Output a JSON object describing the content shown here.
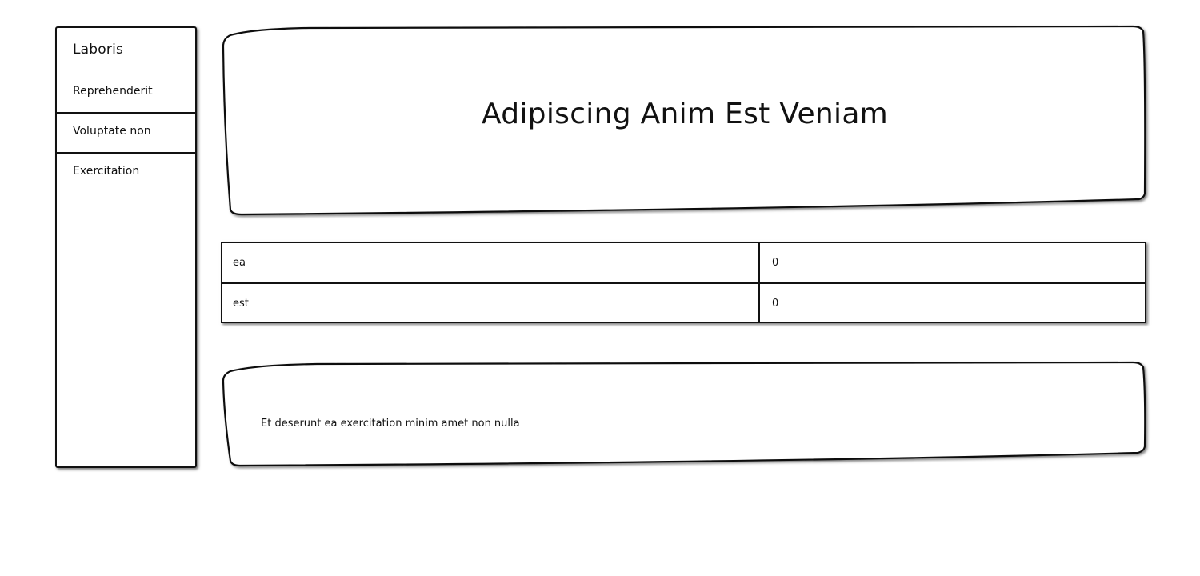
{
  "sidebar": {
    "title": "Laboris",
    "items": [
      {
        "label": "Reprehenderit"
      },
      {
        "label": "Voluptate non"
      },
      {
        "label": "Exercitation"
      }
    ]
  },
  "hero": {
    "title": "Adipiscing Anim Est Veniam"
  },
  "table": {
    "rows": [
      {
        "name": "ea",
        "value": "0"
      },
      {
        "name": "est",
        "value": "0"
      }
    ]
  },
  "note": {
    "text": "Et deserunt ea exercitation minim amet non nulla"
  },
  "colors": {
    "border": "#111111",
    "background": "#ffffff"
  }
}
